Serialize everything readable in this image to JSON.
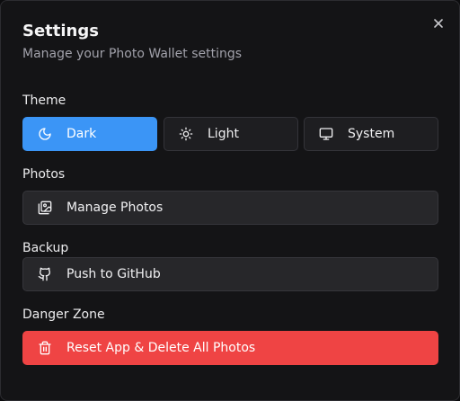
{
  "dialog": {
    "title": "Settings",
    "subtitle": "Manage your Photo Wallet settings",
    "close_icon": "close-icon"
  },
  "theme": {
    "label": "Theme",
    "selected": "Dark",
    "options": [
      {
        "label": "Dark",
        "icon": "moon-icon",
        "active": true
      },
      {
        "label": "Light",
        "icon": "sun-icon",
        "active": false
      },
      {
        "label": "System",
        "icon": "monitor-icon",
        "active": false
      }
    ]
  },
  "photos": {
    "label": "Photos",
    "button_label": "Manage Photos",
    "icon": "images-icon"
  },
  "backup": {
    "label": "Backup",
    "button_label": "Push to GitHub",
    "icon": "github-icon"
  },
  "danger": {
    "label": "Danger Zone",
    "button_label": "Reset App & Delete All Photos",
    "icon": "trash-icon"
  },
  "colors": {
    "accent": "#3b95f6",
    "danger": "#ef4444",
    "background": "#141416"
  }
}
